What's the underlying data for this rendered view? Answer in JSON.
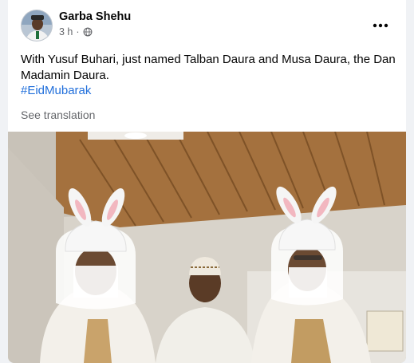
{
  "post": {
    "author": "Garba Shehu",
    "time": "3 h",
    "separator": "·",
    "audience_icon": "globe-icon",
    "more_icon": "more-options-icon",
    "text": "With Yusuf Buhari, just named Talban Daura and Musa Daura, the Dan Madamin Daura.",
    "hashtag": "#EidMubarak",
    "see_translation": "See translation",
    "photo_icon": "post-photo"
  },
  "colors": {
    "background": "#f0f2f5",
    "card": "#ffffff",
    "primary_text": "#050505",
    "secondary_text": "#65676b",
    "link": "#216fdb"
  }
}
